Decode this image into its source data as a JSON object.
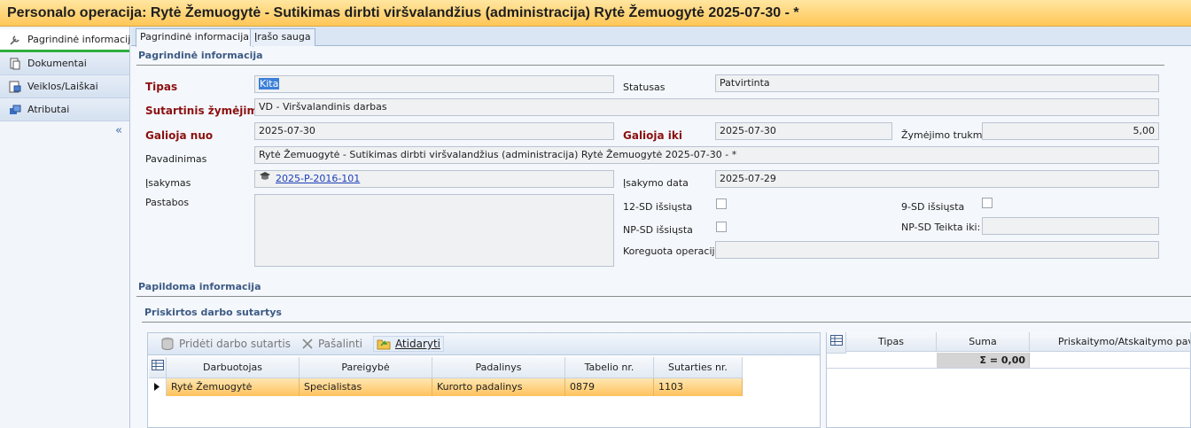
{
  "window": {
    "title": "Personalo operacija: Rytė Žemuogytė - Sutikimas dirbti viršvalandžius (administracija) Rytė Žemuogytė 2025-07-30 - *"
  },
  "sidebar": {
    "items": [
      {
        "label": "Pagrindinė informacija"
      },
      {
        "label": "Dokumentai"
      },
      {
        "label": "Veiklos/Laiškai"
      },
      {
        "label": "Atributai"
      }
    ],
    "collapse_glyph": "«"
  },
  "tabs": [
    {
      "label": "Pagrindinė informacija"
    },
    {
      "label": "Įrašo sauga"
    }
  ],
  "main": {
    "section_title": "Pagrindinė informacija",
    "fields": {
      "tipas": {
        "label": "Tipas",
        "value": "Kita"
      },
      "statusas": {
        "label": "Statusas",
        "value": "Patvirtinta"
      },
      "sutartinis": {
        "label": "Sutartinis žymėjimas",
        "value": "VD - Viršvalandinis darbas"
      },
      "galioja_nuo": {
        "label": "Galioja nuo",
        "value": "2025-07-30"
      },
      "galioja_iki": {
        "label": "Galioja iki",
        "value": "2025-07-30"
      },
      "trukme": {
        "label": "Žymėjimo trukmė",
        "value": "5,00"
      },
      "pavadinimas": {
        "label": "Pavadinimas",
        "value": "Rytė Žemuogytė - Sutikimas dirbti viršvalandžius (administracija) Rytė Žemuogytė 2025-07-30 - *"
      },
      "isakymas": {
        "label": "Įsakymas",
        "value": "2025-P-2016-101"
      },
      "isakymo_data": {
        "label": "Įsakymo data",
        "value": "2025-07-29"
      },
      "pastabos": {
        "label": "Pastabos",
        "value": ""
      },
      "sd12": {
        "label": "12-SD išsiųsta",
        "checked": false
      },
      "sd9": {
        "label": "9-SD išsiųsta",
        "checked": false
      },
      "npsd": {
        "label": "NP-SD išsiųsta",
        "checked": false
      },
      "npsd_teikta": {
        "label": "NP-SD Teikta iki:",
        "value": ""
      },
      "koreguota": {
        "label": "Koreguota operacija",
        "value": ""
      }
    },
    "extra_section": "Papildoma informacija",
    "contracts_section": "Priskirtos darbo sutartys"
  },
  "toolbar": {
    "add_label": "Pridėti darbo sutartis",
    "remove_label": "Pašalinti",
    "open_label": "Atidaryti"
  },
  "contracts_grid": {
    "columns": [
      "Darbuotojas",
      "Pareigybė",
      "Padalinys",
      "Tabelio nr.",
      "Sutarties nr."
    ],
    "rows": [
      [
        "Rytė Žemuogytė",
        "Specialistas",
        "Kurorto padalinys",
        "0879",
        "1103"
      ]
    ]
  },
  "summary_grid": {
    "columns": [
      "Tipas",
      "Suma",
      "Priskaitymo/Atskaitymo pavad"
    ],
    "total": "Σ = 0,00"
  },
  "colors": {
    "title_bar": "#ffc657",
    "required_label": "#8b1010",
    "selected_row": "#ffc25c",
    "active_indicator": "#2fae3d"
  }
}
